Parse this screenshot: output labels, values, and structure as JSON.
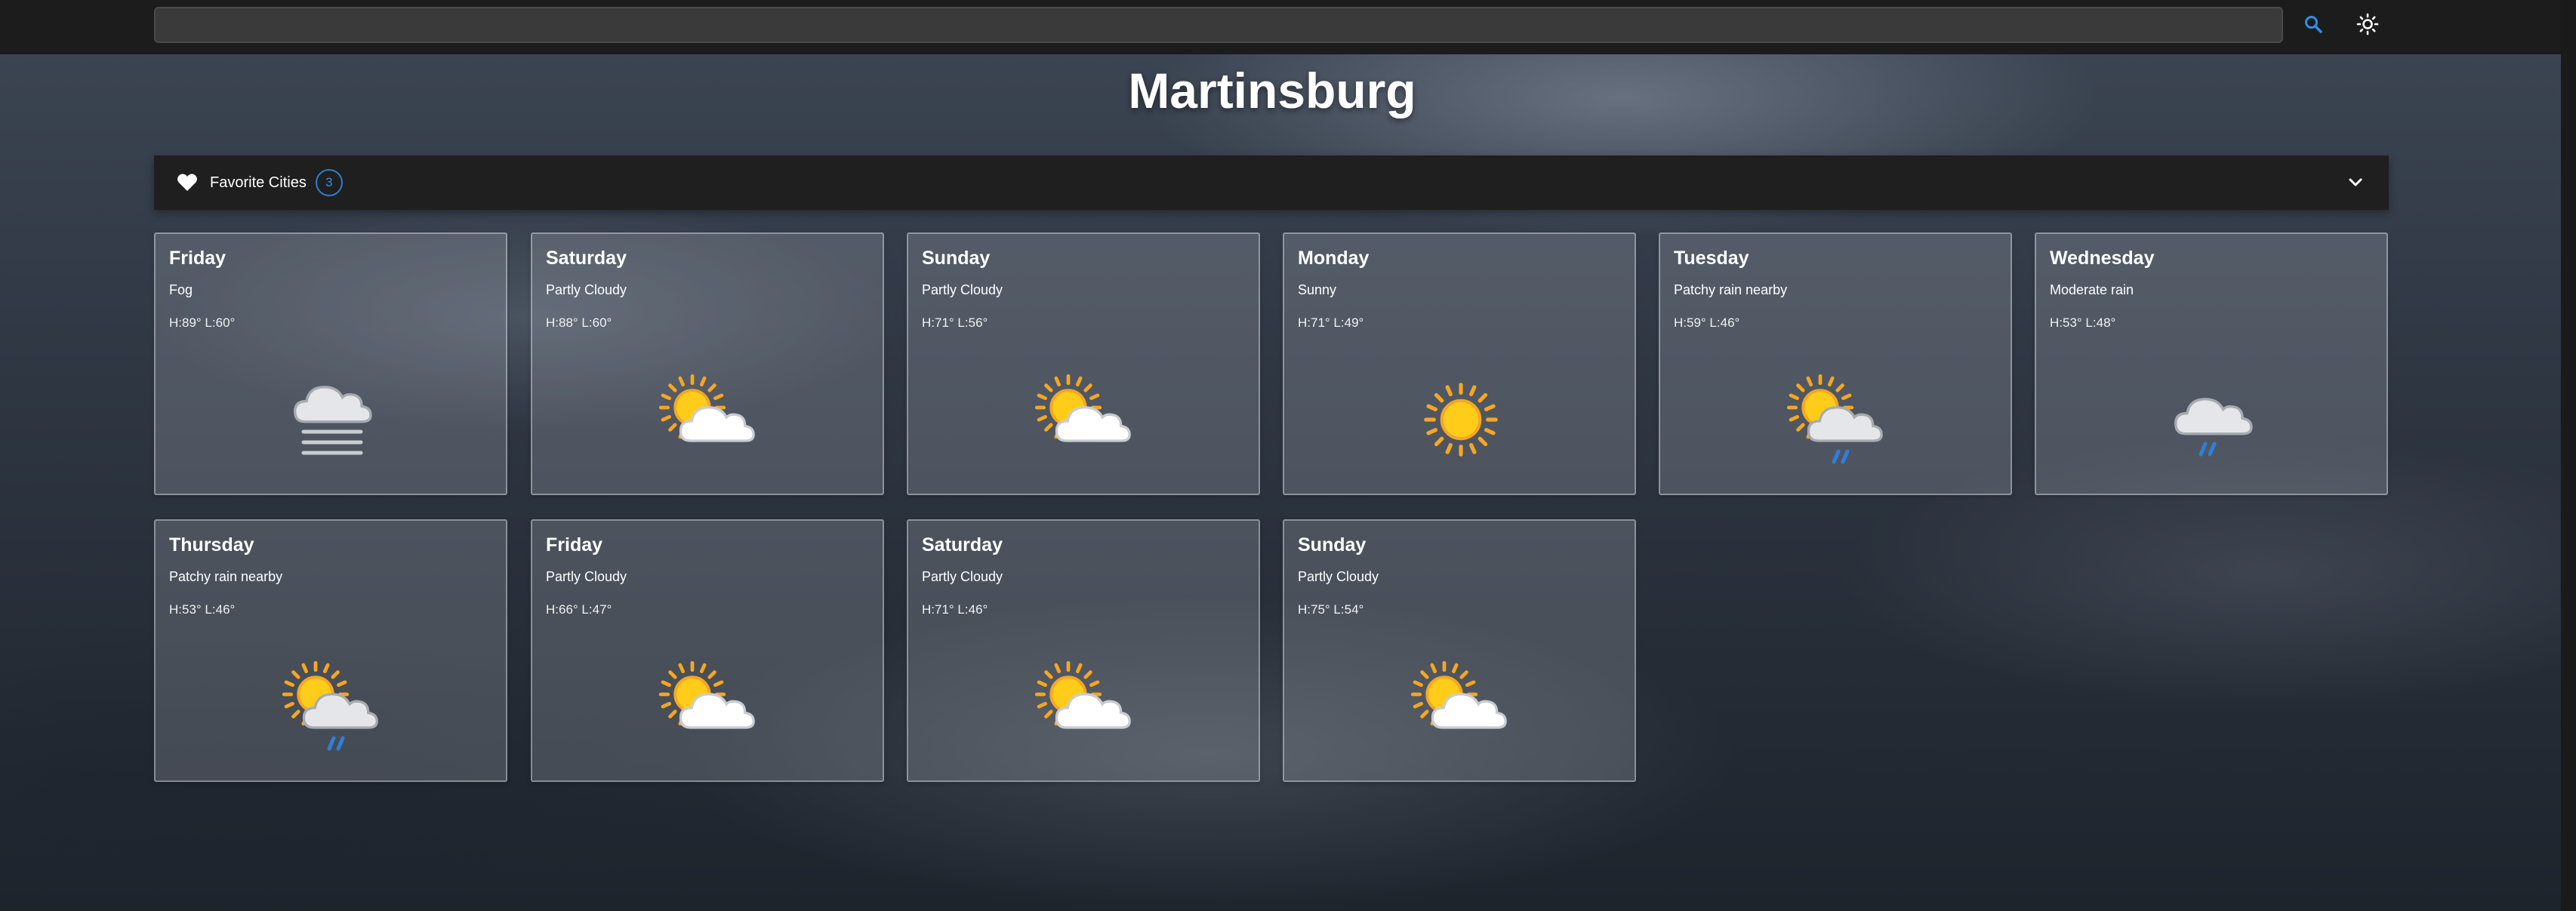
{
  "search": {
    "value": "",
    "placeholder": ""
  },
  "header": {
    "city": "Martinsburg"
  },
  "favorites": {
    "label": "Favorite Cities",
    "count": "3"
  },
  "colors": {
    "accent": "#2f7fc9",
    "topbar": "#1c1c1c",
    "favorites_bar": "#1f1f1f"
  },
  "forecast": [
    {
      "day": "Friday",
      "condition": "Fog",
      "temps": "H:89° L:60°",
      "icon": "fog-icon"
    },
    {
      "day": "Saturday",
      "condition": "Partly Cloudy",
      "temps": "H:88° L:60°",
      "icon": "partly-cloudy-icon"
    },
    {
      "day": "Sunday",
      "condition": "Partly Cloudy",
      "temps": "H:71° L:56°",
      "icon": "partly-cloudy-icon"
    },
    {
      "day": "Monday",
      "condition": "Sunny",
      "temps": "H:71° L:49°",
      "icon": "sunny-icon"
    },
    {
      "day": "Tuesday",
      "condition": "Patchy rain nearby",
      "temps": "H:59° L:46°",
      "icon": "patchy-rain-icon"
    },
    {
      "day": "Wednesday",
      "condition": "Moderate rain",
      "temps": "H:53° L:48°",
      "icon": "moderate-rain-icon"
    },
    {
      "day": "Thursday",
      "condition": "Patchy rain nearby",
      "temps": "H:53° L:46°",
      "icon": "patchy-rain-icon"
    },
    {
      "day": "Friday",
      "condition": "Partly Cloudy",
      "temps": "H:66° L:47°",
      "icon": "partly-cloudy-icon"
    },
    {
      "day": "Saturday",
      "condition": "Partly Cloudy",
      "temps": "H:71° L:46°",
      "icon": "partly-cloudy-icon"
    },
    {
      "day": "Sunday",
      "condition": "Partly Cloudy",
      "temps": "H:75° L:54°",
      "icon": "partly-cloudy-icon"
    }
  ]
}
